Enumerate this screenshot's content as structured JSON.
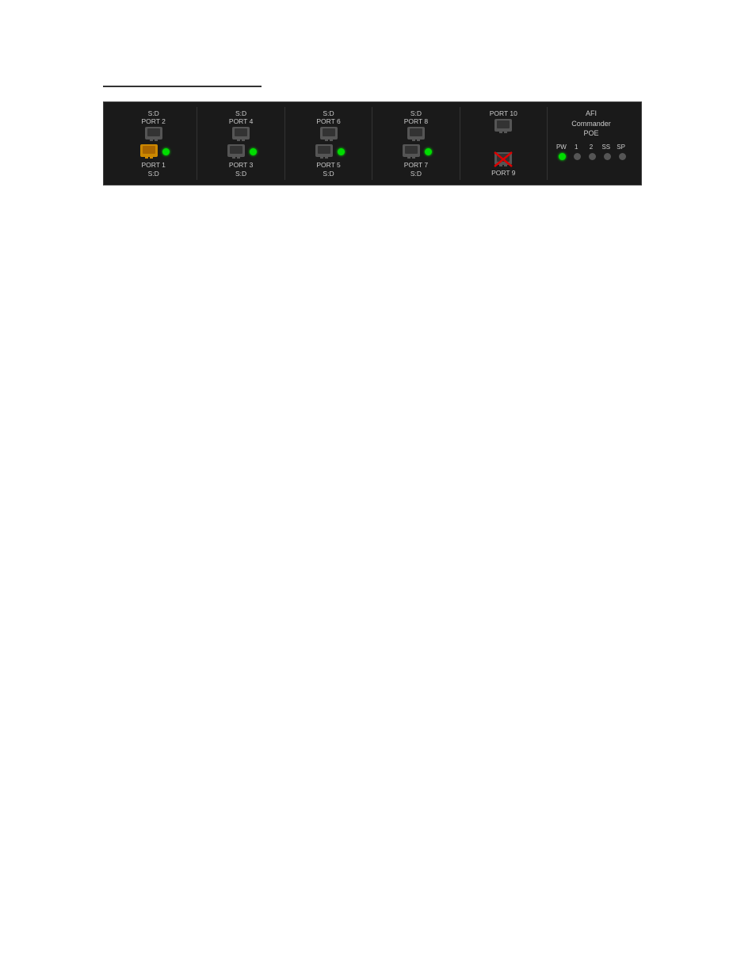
{
  "separator": true,
  "panel": {
    "title": "AFI Commander POE",
    "ports": [
      {
        "id": "col1",
        "top": {
          "label": "S:D",
          "port": "PORT 2",
          "color": "gray"
        },
        "bottom": {
          "label": "PORT 1",
          "sd": "S:D",
          "color": "orange",
          "led": "green"
        }
      },
      {
        "id": "col2",
        "top": {
          "label": "S:D",
          "port": "PORT 4",
          "color": "gray"
        },
        "bottom": {
          "label": "PORT 3",
          "sd": "S:D",
          "color": "gray",
          "led": "green"
        }
      },
      {
        "id": "col3",
        "top": {
          "label": "S:D",
          "port": "PORT 6",
          "color": "gray"
        },
        "bottom": {
          "label": "PORT 5",
          "sd": "S:D",
          "color": "gray",
          "led": "green"
        }
      },
      {
        "id": "col4",
        "top": {
          "label": "S:D",
          "port": "PORT 8",
          "color": "gray"
        },
        "bottom": {
          "label": "PORT 7",
          "sd": "S:D",
          "color": "gray",
          "led": "green"
        }
      },
      {
        "id": "col5",
        "top": {
          "label": "",
          "port": "PORT 10",
          "color": "gray"
        },
        "bottom": {
          "label": "PORT 9",
          "sd": "",
          "color": "crossed"
        }
      }
    ],
    "afi": {
      "title": "AFI\nCommander\nPOE",
      "indicators": [
        {
          "label": "PW",
          "led": "green"
        },
        {
          "label": "1",
          "led": "gray"
        },
        {
          "label": "2",
          "led": "gray"
        },
        {
          "label": "SS",
          "led": "gray"
        },
        {
          "label": "SP",
          "led": "gray"
        }
      ]
    }
  }
}
